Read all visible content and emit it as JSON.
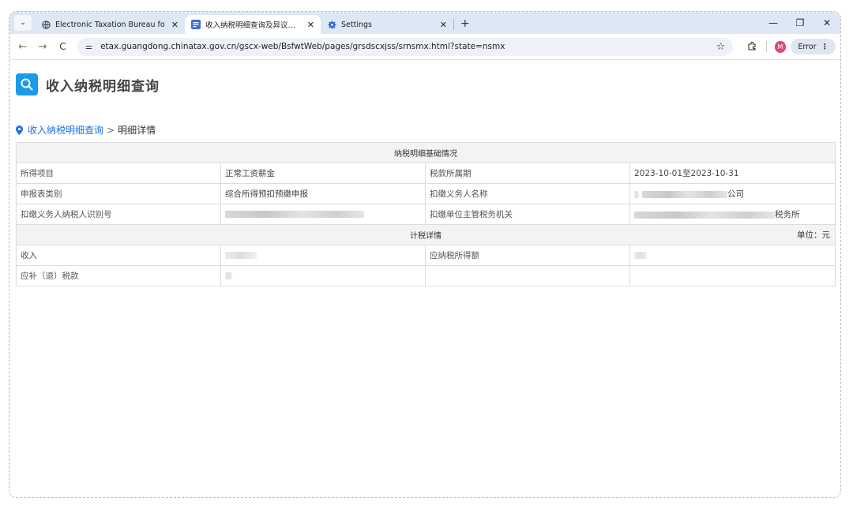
{
  "browser": {
    "tabs": [
      {
        "title": "Electronic Taxation Bureau fo",
        "active": false
      },
      {
        "title": "收入纳税明细查询及异议申请",
        "active": true
      },
      {
        "title": "Settings",
        "active": false
      }
    ],
    "url": "etax.guangdong.chinatax.gov.cn/gscx-web/BsfwtWeb/pages/grsdscxjss/srnsmx.html?state=nsmx",
    "profile_initial": "M",
    "error_label": "Error",
    "profile_color": "#e0457b",
    "tab_bar_color": "#dee7f4"
  },
  "page": {
    "title": "收入纳税明细查询",
    "breadcrumb": {
      "link": "收入纳税明细查询",
      "separator": ">",
      "current": "明细详情"
    },
    "accent_color": "#1a9ae8"
  },
  "table": {
    "section_basic": "纳税明细基础情况",
    "rows_basic": [
      {
        "label1": "所得项目",
        "value1": "正常工资薪金",
        "label2": "税款所属期",
        "value2": "2023-10-01至2023-10-31"
      },
      {
        "label1": "申报表类别",
        "value1": "综合所得预扣预缴申报",
        "label2": "扣缴义务人名称",
        "value2_suffix": "公司"
      },
      {
        "label1": "扣缴义务人纳税人识别号",
        "label2": "扣缴单位主管税务机关",
        "value2_suffix": "税务所"
      }
    ],
    "section_tax": "计税详情",
    "unit": "单位：元",
    "rows_tax": [
      {
        "label1": "收入",
        "label2": "应纳税所得额"
      },
      {
        "label1": "应补（退）税款"
      }
    ]
  }
}
